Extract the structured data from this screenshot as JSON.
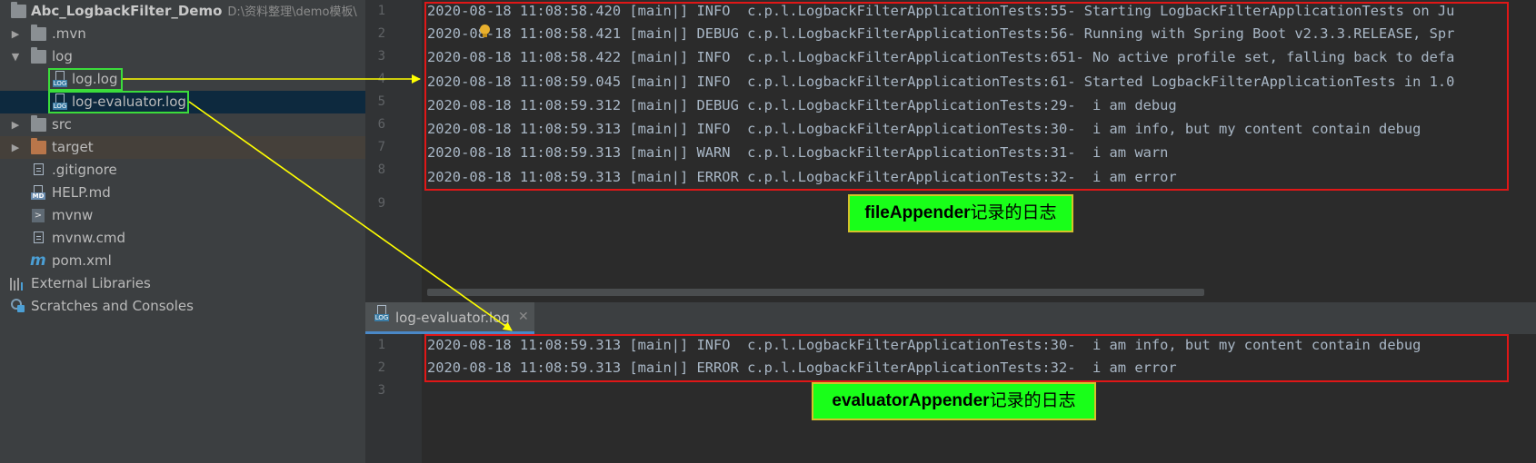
{
  "project": {
    "root_name": "Abc_LogbackFilter_Demo",
    "root_path": "D:\\资料整理\\demo模板\\",
    "items": [
      {
        "label": ".mvn"
      },
      {
        "label": "log"
      },
      {
        "label": "log.log"
      },
      {
        "label": "log-evaluator.log"
      },
      {
        "label": "src"
      },
      {
        "label": "target"
      },
      {
        "label": ".gitignore"
      },
      {
        "label": "HELP.md"
      },
      {
        "label": "mvnw"
      },
      {
        "label": "mvnw.cmd"
      },
      {
        "label": "pom.xml"
      },
      {
        "label": "External Libraries"
      },
      {
        "label": "Scratches and Consoles"
      }
    ]
  },
  "icons": {
    "folder": "folder-icon",
    "log_file": "log-file-icon",
    "markdown_file": "markdown-file-icon",
    "maven": "maven-icon",
    "libraries": "libraries-icon",
    "scratches": "scratches-icon",
    "arrow_expanded": "▼",
    "arrow_collapsed": "▶",
    "log_tag": "LOG",
    "md_tag": "MD",
    "mvn_tag": "m",
    "close_glyph": "✕"
  },
  "editor_top": {
    "line_numbers": [
      "1",
      "2",
      "3",
      "4",
      "5",
      "6",
      "7",
      "8",
      "9"
    ],
    "lines": [
      "2020-08-18 11:08:58.420 [main|] INFO  c.p.l.LogbackFilterApplicationTests:55- Starting LogbackFilterApplicationTests on Ju",
      "2020-08-18 11:08:58.421 [main|] DEBUG c.p.l.LogbackFilterApplicationTests:56- Running with Spring Boot v2.3.3.RELEASE, Spr",
      "2020-08-18 11:08:58.422 [main|] INFO  c.p.l.LogbackFilterApplicationTests:651- No active profile set, falling back to defa",
      "2020-08-18 11:08:59.045 [main|] INFO  c.p.l.LogbackFilterApplicationTests:61- Started LogbackFilterApplicationTests in 1.0",
      "2020-08-18 11:08:59.312 [main|] DEBUG c.p.l.LogbackFilterApplicationTests:29-  i am debug",
      "2020-08-18 11:08:59.313 [main|] INFO  c.p.l.LogbackFilterApplicationTests:30-  i am info, but my content contain debug",
      "2020-08-18 11:08:59.313 [main|] WARN  c.p.l.LogbackFilterApplicationTests:31-  i am warn",
      "2020-08-18 11:08:59.313 [main|] ERROR c.p.l.LogbackFilterApplicationTests:32-  i am error"
    ],
    "annotation_en": "fileAppender",
    "annotation_cn": "记录的日志"
  },
  "editor_bottom": {
    "tab_label": "log-evaluator.log",
    "line_numbers": [
      "1",
      "2",
      "3"
    ],
    "lines": [
      "2020-08-18 11:08:59.313 [main|] INFO  c.p.l.LogbackFilterApplicationTests:30-  i am info, but my content contain debug",
      "2020-08-18 11:08:59.313 [main|] ERROR c.p.l.LogbackFilterApplicationTests:32-  i am error"
    ],
    "annotation_en": "evaluatorAppender",
    "annotation_cn": "记录的日志"
  },
  "colors": {
    "background": "#2b2b2b",
    "sidebar": "#3c3f41",
    "text": "#a9b7c6",
    "highlight_red": "#e01717",
    "highlight_green": "#3bdc3b",
    "label_fill": "#19ff19",
    "arrow_yellow": "#ffff00"
  }
}
